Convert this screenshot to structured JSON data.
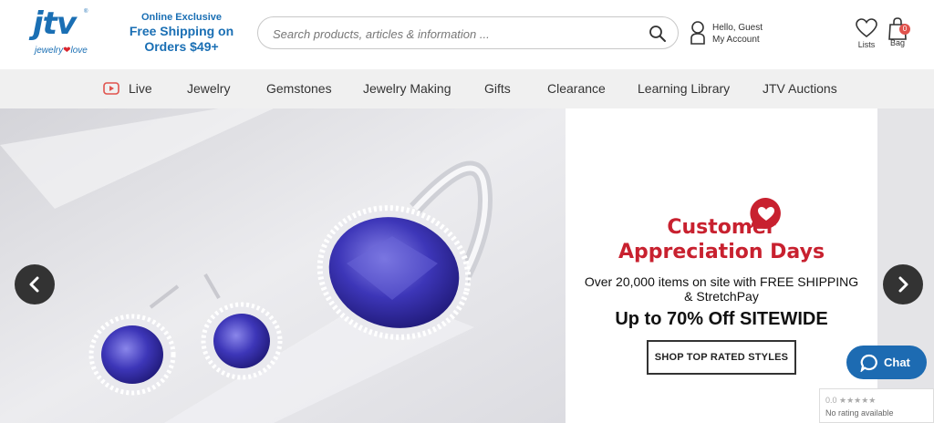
{
  "header": {
    "logo_text": "jtv",
    "logo_tagline_pre": "jewelry",
    "logo_tagline_post": "love",
    "promo_small": "Online Exclusive",
    "promo_line1": "Free Shipping on",
    "promo_line2": "Orders $49+",
    "search_placeholder": "Search products, articles & information ...",
    "greeting": "Hello, Guest",
    "account_label": "My Account",
    "lists_label": "Lists",
    "bag_label": "Bag",
    "bag_count": "0"
  },
  "nav": {
    "items": [
      "Live",
      "Jewelry",
      "Gemstones",
      "Jewelry Making",
      "Gifts",
      "Clearance",
      "Learning Library",
      "JTV Auctions"
    ]
  },
  "hero": {
    "title_line1": "Customer",
    "title_line2": "Appreciation Days",
    "description": "Over 20,000 items on site with FREE SHIPPING & StretchPay",
    "offer": "Up to 70% Off SITEWIDE",
    "cta": "SHOP TOP RATED STYLES"
  },
  "chat": {
    "label": "Chat"
  },
  "rating": {
    "score": "0.0 ★★★★★",
    "text": "No rating available"
  },
  "colors": {
    "brand_blue": "#1a6fb4",
    "promo_red": "#c8212f",
    "chat_blue": "#1d6bb2"
  }
}
